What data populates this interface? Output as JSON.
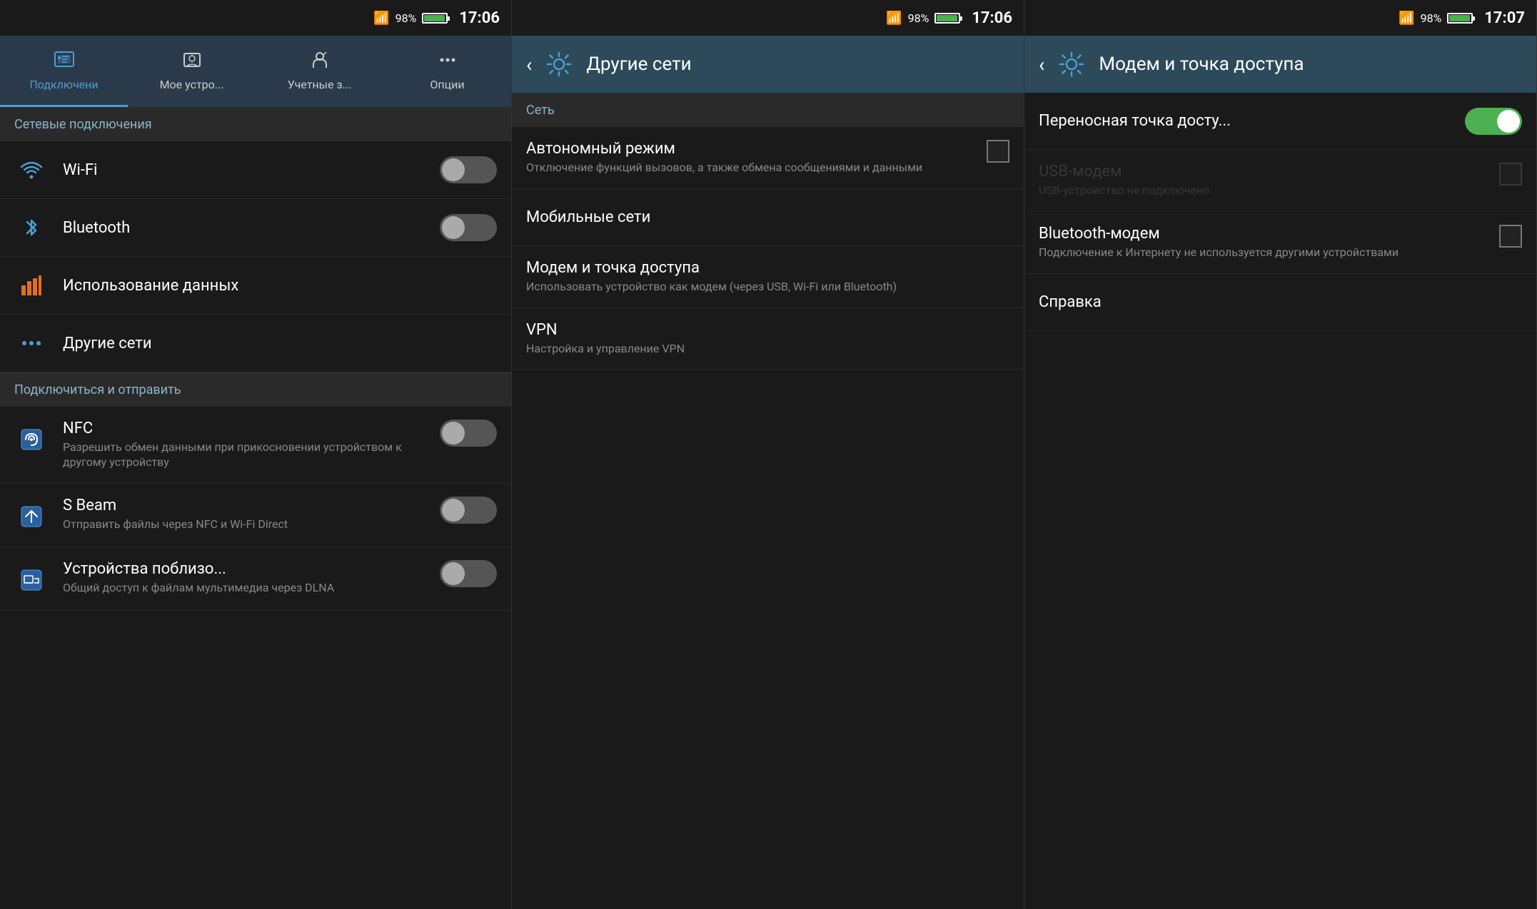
{
  "panel1": {
    "statusBar": {
      "battery": "98%",
      "time": "17:06"
    },
    "tabs": [
      {
        "id": "connections",
        "label": "Подключени",
        "icon": "connections",
        "active": true
      },
      {
        "id": "mydevice",
        "label": "Мое устро...",
        "icon": "mydevice",
        "active": false
      },
      {
        "id": "accounts",
        "label": "Учетные з...",
        "icon": "accounts",
        "active": false
      },
      {
        "id": "options",
        "label": "Опции",
        "icon": "options",
        "active": false
      }
    ],
    "sectionNetwork": "Сетевые подключения",
    "items": [
      {
        "id": "wifi",
        "title": "Wi-Fi",
        "icon": "wifi",
        "toggle": true,
        "toggleOn": false
      },
      {
        "id": "bluetooth",
        "title": "Bluetooth",
        "icon": "bluetooth",
        "toggle": true,
        "toggleOn": false
      },
      {
        "id": "datausage",
        "title": "Использование данных",
        "icon": "datausage",
        "toggle": false
      }
    ],
    "otherNetworksTitle": "Другие сети",
    "sectionConnect": "Подключиться и отправить",
    "connectItems": [
      {
        "id": "nfc",
        "title": "NFC",
        "subtitle": "Разрешить обмен данными при прикосновении устройством к другому устройству",
        "icon": "nfc",
        "toggle": true,
        "toggleOn": false
      },
      {
        "id": "sbeam",
        "title": "S Beam",
        "subtitle": "Отправить файлы через NFC и Wi-Fi Direct",
        "icon": "sbeam",
        "toggle": true,
        "toggleOn": false
      },
      {
        "id": "nearbydevices",
        "title": "Устройства поблизо...",
        "subtitle": "Общий доступ к файлам мультимедиа через DLNA",
        "icon": "nearbydevices",
        "toggle": true,
        "toggleOn": false
      }
    ]
  },
  "panel2": {
    "statusBar": {
      "battery": "98%",
      "time": "17:06"
    },
    "headerTitle": "Другие сети",
    "sectionNetwork": "Сеть",
    "items": [
      {
        "id": "airplane",
        "title": "Автономный режим",
        "subtitle": "Отключение функций вызовов, а также обмена сообщениями и данными",
        "checkbox": true
      },
      {
        "id": "mobile",
        "title": "Мобильные сети",
        "subtitle": ""
      },
      {
        "id": "tethering",
        "title": "Модем и точка доступа",
        "subtitle": "Использовать устройство как модем (через USB, Wi-Fi или Bluetooth)"
      },
      {
        "id": "vpn",
        "title": "VPN",
        "subtitle": "Настройка и управление VPN"
      }
    ]
  },
  "panel3": {
    "statusBar": {
      "battery": "98%",
      "time": "17:07"
    },
    "headerTitle": "Модем и точка доступа",
    "items": [
      {
        "id": "hotspot",
        "title": "Переносная точка досту...",
        "subtitle": "",
        "toggleOn": true
      },
      {
        "id": "usbmodem",
        "title": "USB-модем",
        "subtitle": "USB-устройство не подключено",
        "disabled": true,
        "checkbox": true
      },
      {
        "id": "btmodem",
        "title": "Bluetooth-модем",
        "subtitle": "Подключение к Интернету не используется другими устройствами",
        "disabled": false,
        "checkbox": true
      },
      {
        "id": "help",
        "title": "Справка",
        "subtitle": ""
      }
    ]
  }
}
